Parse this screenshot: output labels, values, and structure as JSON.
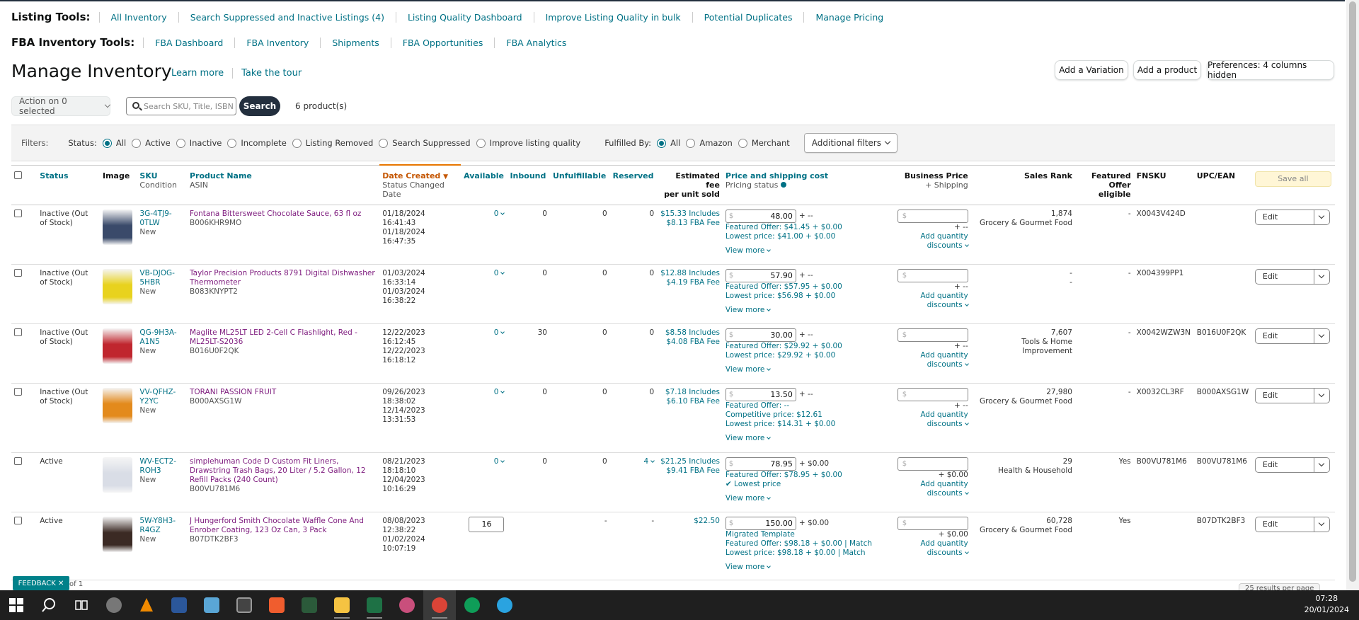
{
  "listing_tools": {
    "label": "Listing Tools:",
    "items": [
      "All Inventory",
      "Search Suppressed and Inactive Listings (4)",
      "Listing Quality Dashboard",
      "Improve Listing Quality in bulk",
      "Potential Duplicates",
      "Manage Pricing"
    ]
  },
  "fba_tools": {
    "label": "FBA Inventory Tools:",
    "items": [
      "FBA Dashboard",
      "FBA Inventory",
      "Shipments",
      "FBA Opportunities",
      "FBA Analytics"
    ]
  },
  "page": {
    "title": "Manage Inventory",
    "learn_more": "Learn more",
    "take_tour": "Take the tour",
    "add_variation": "Add a Variation",
    "add_product": "Add a product",
    "preferences": "Preferences: 4 columns hidden",
    "action": "Action on 0 selected",
    "search_placeholder": "Search SKU, Title, ISBN",
    "search_button": "Search",
    "product_count": "6 product(s)"
  },
  "filters": {
    "label": "Filters:",
    "status_label": "Status:",
    "status_options": [
      "All",
      "Active",
      "Inactive",
      "Incomplete",
      "Listing Removed",
      "Search Suppressed",
      "Improve listing quality"
    ],
    "fulfilled_label": "Fulfilled By:",
    "fulfilled_options": [
      "All",
      "Amazon",
      "Merchant"
    ],
    "additional": "Additional filters"
  },
  "columns": {
    "status": "Status",
    "image": "Image",
    "sku": "SKU",
    "sku_sub": "Condition",
    "product_name": "Product Name",
    "product_sub": "ASIN",
    "date_created": "Date Created",
    "date_sub": "Status Changed Date",
    "available": "Available",
    "inbound": "Inbound",
    "unfulfillable": "Unfulfillable",
    "reserved": "Reserved",
    "est_fee": "Estimated fee",
    "est_fee_sub": "per unit sold",
    "price": "Price and shipping cost",
    "price_sub": "Pricing status",
    "business": "Business Price",
    "business_sub": "+ Shipping",
    "sales_rank": "Sales Rank",
    "featured": "Featured",
    "featured_sub": "Offer eligible",
    "fnsku": "FNSKU",
    "upc": "UPC/EAN",
    "save_all": "Save all"
  },
  "rows": [
    {
      "status": "Inactive (Out of Stock)",
      "sku": "3G-4TJ9-0TLW",
      "condition": "New",
      "name": "Fontana Bittersweet Chocolate Sauce, 63 fl oz",
      "asin": "B006KHR9MO",
      "created": "01/18/2024 16:41:43",
      "changed": "01/18/2024 16:47:35",
      "available": "0",
      "inbound": "0",
      "unfulfillable": "0",
      "reserved": "0",
      "fee1": "$15.33 Includes",
      "fee2": "$8.13 FBA Fee",
      "price": "48.00",
      "ship": "+ --",
      "line1": "Featured Offer: $41.45 + $0.00",
      "line2": "Lowest price: $41.00 + $0.00",
      "line3": "",
      "rank": "1,874",
      "category": "Grocery & Gourmet Food",
      "featured": "-",
      "fnsku": "X0043V424D",
      "upc": "",
      "img_color": "#3a4a6a"
    },
    {
      "status": "Inactive (Out of Stock)",
      "sku": "VB-DJOG-5HBR",
      "condition": "New",
      "name": "Taylor Precision Products 8791 Digital Dishwasher Thermometer",
      "asin": "B083KNYPT2",
      "created": "01/03/2024 16:33:14",
      "changed": "01/03/2024 16:38:22",
      "available": "0",
      "inbound": "0",
      "unfulfillable": "0",
      "reserved": "0",
      "fee1": "$12.88 Includes",
      "fee2": "$4.19 FBA Fee",
      "price": "57.90",
      "ship": "+ --",
      "line1": "Featured Offer: $57.95 + $0.00",
      "line2": "Lowest price: $56.98 + $0.00",
      "line3": "",
      "rank": "-",
      "category": "-",
      "featured": "-",
      "fnsku": "X004399PP1",
      "upc": "",
      "img_color": "#e8d21e"
    },
    {
      "status": "Inactive (Out of Stock)",
      "sku": "QG-9H3A-A1N5",
      "condition": "New",
      "name": "Maglite ML25LT LED 2-Cell C Flashlight, Red - ML25LT-S2036",
      "asin": "B016U0F2QK",
      "created": "12/22/2023 16:12:45",
      "changed": "12/22/2023 16:18:12",
      "available": "0",
      "inbound": "30",
      "unfulfillable": "0",
      "reserved": "0",
      "fee1": "$8.58 Includes",
      "fee2": "$4.08 FBA Fee",
      "price": "30.00",
      "ship": "+ --",
      "line1": "Featured Offer: $29.92 + $0.00",
      "line2": "Lowest price: $29.92 + $0.00",
      "line3": "",
      "rank": "7,607",
      "category": "Tools & Home Improvement",
      "featured": "-",
      "fnsku": "X0042WZW3N",
      "upc": "B016U0F2QK",
      "img_color": "#c0262e"
    },
    {
      "status": "Inactive (Out of Stock)",
      "sku": "VV-QFHZ-Y2YC",
      "condition": "New",
      "name": "TORANI PASSION FRUIT",
      "asin": "B000AXSG1W",
      "created": "09/26/2023 18:38:02",
      "changed": "12/14/2023 13:31:53",
      "available": "0",
      "inbound": "0",
      "unfulfillable": "0",
      "reserved": "0",
      "fee1": "$7.18 Includes",
      "fee2": "$6.10 FBA Fee",
      "price": "13.50",
      "ship": "+ --",
      "line1": "Featured Offer: --",
      "line2": "Competitive price: $12.61",
      "line3": "Lowest price: $14.31 + $0.00",
      "rank": "27,980",
      "category": "Grocery & Gourmet Food",
      "featured": "-",
      "fnsku": "X0032CL3RF",
      "upc": "B000AXSG1W",
      "img_color": "#e38a1c"
    },
    {
      "status": "Active",
      "sku": "WV-ECT2-ROH3",
      "condition": "New",
      "name": "simplehuman Code D Custom Fit Liners, Drawstring Trash Bags, 20 Liter / 5.2 Gallon, 12 Refill Packs (240 Count)",
      "asin": "B00VU781M6",
      "created": "08/21/2023 18:18:10",
      "changed": "12/04/2023 10:16:29",
      "available": "0",
      "inbound": "0",
      "unfulfillable": "0",
      "reserved": "4",
      "fee1": "$21.25 Includes",
      "fee2": "$9.41 FBA Fee",
      "price": "78.95",
      "ship": "+ $0.00",
      "line1": "Featured Offer: $78.95 + $0.00",
      "line2": "✔ Lowest price",
      "line3": "",
      "rank": "29",
      "category": "Health & Household",
      "featured": "Yes",
      "fnsku": "B00VU781M6",
      "upc": "B00VU781M6",
      "img_color": "#d9dde6"
    },
    {
      "status": "Active",
      "sku": "5W-Y8H3-R4GZ",
      "condition": "New",
      "name": "J Hungerford Smith Chocolate Waffle Cone And Enrober Coating, 123 Oz Can, 3 Pack",
      "asin": "B07DTK2BF3",
      "created": "08/08/2023 12:38:22",
      "changed": "01/02/2024 10:07:19",
      "available": "16",
      "inbound": "",
      "unfulfillable": "-",
      "reserved": "-",
      "fee1": "$22.50",
      "fee2": "",
      "price": "150.00",
      "ship": "+ $0.00",
      "line1": "Migrated Template",
      "line2": "Featured Offer: $98.18 + $0.00 | Match",
      "line3": "Lowest price: $98.18 + $0.00 | Match",
      "rank": "60,728",
      "category": "Grocery & Gourmet Food",
      "featured": "Yes",
      "fnsku": "",
      "upc": "B07DTK2BF3",
      "img_color": "#3b2a24"
    }
  ],
  "row_labels": {
    "view_more": "View more",
    "add_qty": "Add quantity",
    "discounts": "discounts",
    "edit": "Edit",
    "dollar": "$",
    "plus_dash": "+ --",
    "plus_zero": "+ $0.00"
  },
  "footer": {
    "feedback": "FEEDBACK ✕",
    "page_of": "of 1",
    "per_page": "25 results per page"
  },
  "taskbar": {
    "time": "07:28",
    "date": "20/01/2024"
  }
}
